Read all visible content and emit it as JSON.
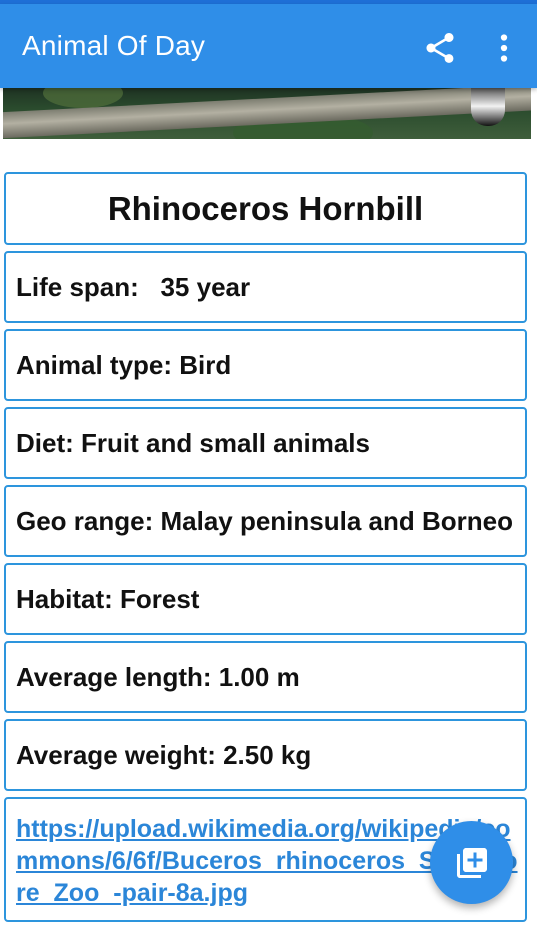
{
  "appbar": {
    "title": "Animal Of Day",
    "share_icon": "share-icon",
    "more_icon": "more-vert-icon"
  },
  "photo": {
    "description_icon": "animal-photo"
  },
  "animal": {
    "name": "Rhinoceros Hornbill",
    "life_span": "Life span:   35 year",
    "animal_type": "Animal type: Bird",
    "diet": "Diet: Fruit and small animals",
    "geo_range": "Geo range: Malay peninsula and Borneo",
    "habitat": "Habitat: Forest",
    "average_length": "Average length: 1.00 m",
    "average_weight": "Average weight: 2.50 kg",
    "image_link": "https://upload.wikimedia.org/wikipedia/commons/6/6f/Buceros_rhinoceros_Singapore_Zoo_-pair-8a.jpg"
  },
  "fab": {
    "icon": "add-to-library-icon"
  },
  "colors": {
    "primary": "#2f8ee8",
    "status_bar": "#1e6fd6",
    "card_border": "#2d95dd",
    "link": "#2b86d8"
  }
}
